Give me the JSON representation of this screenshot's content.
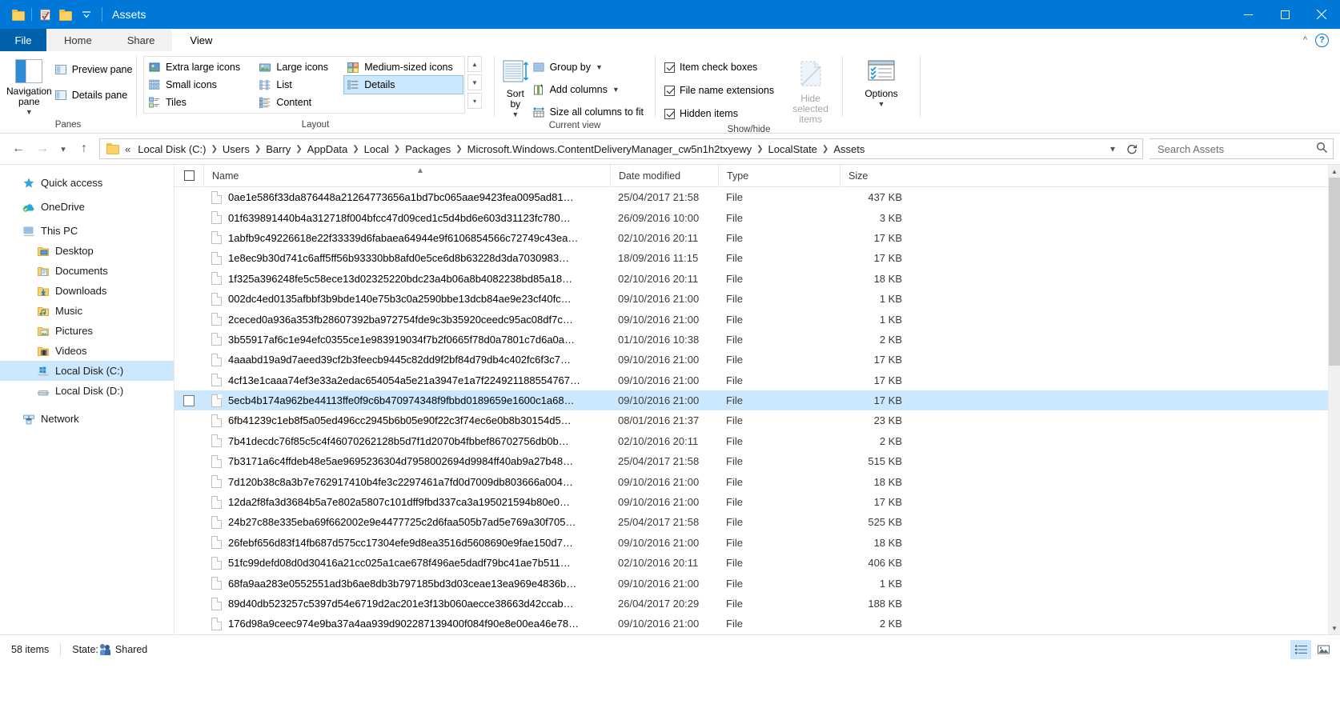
{
  "window": {
    "title": "Assets",
    "quick_access_icons": [
      "folder-icon",
      "properties-icon",
      "new-folder-icon",
      "customize-chevron-icon"
    ],
    "controls": {
      "minimize": "minimize-icon",
      "maximize": "maximize-icon",
      "close": "close-icon"
    }
  },
  "ribbon": {
    "file_tab": "File",
    "tabs": [
      {
        "label": "Home",
        "active": false
      },
      {
        "label": "Share",
        "active": false
      },
      {
        "label": "View",
        "active": true
      }
    ],
    "collapse_icon": "chevron-up-icon",
    "help_icon": "help-icon",
    "groups": [
      {
        "title": "Panes",
        "big_button": {
          "label": "Navigation pane",
          "icon": "navigation-pane-icon",
          "has_dropdown": true
        },
        "items": [
          {
            "label": "Preview pane",
            "icon": "preview-pane-icon"
          },
          {
            "label": "Details pane",
            "icon": "details-pane-icon"
          }
        ]
      },
      {
        "title": "Layout",
        "items": [
          {
            "label": "Extra large icons",
            "icon": "extra-large-icons-icon",
            "selected": false
          },
          {
            "label": "Large icons",
            "icon": "large-icons-icon",
            "selected": false
          },
          {
            "label": "Medium-sized icons",
            "icon": "medium-icons-icon",
            "selected": false
          },
          {
            "label": "Small icons",
            "icon": "small-icons-icon",
            "selected": false
          },
          {
            "label": "List",
            "icon": "list-icon",
            "selected": false
          },
          {
            "label": "Details",
            "icon": "details-icon",
            "selected": true
          },
          {
            "label": "Tiles",
            "icon": "tiles-icon",
            "selected": false
          },
          {
            "label": "Content",
            "icon": "content-icon",
            "selected": false
          }
        ],
        "scroll_icons": [
          "scroll-up-icon",
          "scroll-down-icon",
          "more-icon"
        ]
      },
      {
        "title": "Current view",
        "big_button": {
          "label": "Sort by",
          "icon": "sort-by-icon",
          "has_dropdown": true
        },
        "items": [
          {
            "label": "Group by",
            "icon": "group-by-icon",
            "has_dropdown": true
          },
          {
            "label": "Add columns",
            "icon": "add-columns-icon",
            "has_dropdown": true
          },
          {
            "label": "Size all columns to fit",
            "icon": "size-columns-icon",
            "has_dropdown": false
          }
        ]
      },
      {
        "title": "Show/hide",
        "checkboxes": [
          {
            "label": "Item check boxes",
            "checked": true
          },
          {
            "label": "File name extensions",
            "checked": true
          },
          {
            "label": "Hidden items",
            "checked": true
          }
        ],
        "big_buttons": [
          {
            "label": "Hide selected items",
            "icon": "hide-selected-items-icon",
            "disabled": true
          }
        ]
      },
      {
        "title": "",
        "big_buttons": [
          {
            "label": "Options",
            "icon": "options-icon",
            "has_dropdown": true,
            "disabled": false
          }
        ]
      }
    ]
  },
  "address": {
    "back_icon": "back-arrow-icon",
    "forward_icon": "forward-arrow-icon",
    "recent_icon": "recent-locations-icon",
    "up_icon": "up-arrow-icon",
    "folder_icon": "folder-icon",
    "overflow": "«",
    "crumbs": [
      "Local Disk (C:)",
      "Users",
      "Barry",
      "AppData",
      "Local",
      "Packages",
      "Microsoft.Windows.ContentDeliveryManager_cw5n1h2txyewy",
      "LocalState",
      "Assets"
    ],
    "dropdown_icon": "chevron-down-icon",
    "refresh_icon": "refresh-icon",
    "search_placeholder": "Search Assets",
    "search_icon": "search-icon",
    "search_value": ""
  },
  "sidebar": {
    "items": [
      {
        "label": "Quick access",
        "icon": "star-icon",
        "indent": false,
        "selected": false
      },
      {
        "label": "OneDrive",
        "icon": "onedrive-icon",
        "indent": false,
        "selected": false
      },
      {
        "label": "This PC",
        "icon": "this-pc-icon",
        "indent": false,
        "selected": false
      },
      {
        "label": "Desktop",
        "icon": "desktop-folder-icon",
        "indent": true,
        "selected": false
      },
      {
        "label": "Documents",
        "icon": "documents-folder-icon",
        "indent": true,
        "selected": false
      },
      {
        "label": "Downloads",
        "icon": "downloads-folder-icon",
        "indent": true,
        "selected": false
      },
      {
        "label": "Music",
        "icon": "music-folder-icon",
        "indent": true,
        "selected": false
      },
      {
        "label": "Pictures",
        "icon": "pictures-folder-icon",
        "indent": true,
        "selected": false
      },
      {
        "label": "Videos",
        "icon": "videos-folder-icon",
        "indent": true,
        "selected": false
      },
      {
        "label": "Local Disk (C:)",
        "icon": "windows-drive-icon",
        "indent": true,
        "selected": true
      },
      {
        "label": "Local Disk (D:)",
        "icon": "drive-icon",
        "indent": true,
        "selected": false
      },
      {
        "label": "Network",
        "icon": "network-icon",
        "indent": false,
        "selected": false
      }
    ]
  },
  "filelist": {
    "columns": [
      {
        "key": "name",
        "label": "Name",
        "sorted": true,
        "sort_dir": "asc"
      },
      {
        "key": "date",
        "label": "Date modified"
      },
      {
        "key": "type",
        "label": "Type"
      },
      {
        "key": "size",
        "label": "Size"
      }
    ],
    "header_checkbox": false,
    "rows": [
      {
        "name": "0ae1e586f33da876448a21264773656a1bd7bc065aae9423fea0095ad81…",
        "date": "25/04/2017 21:58",
        "type": "File",
        "size": "437 KB",
        "selected": false
      },
      {
        "name": "01f639891440b4a312718f004bfcc47d09ced1c5d4bd6e603d31123fc780…",
        "date": "26/09/2016 10:00",
        "type": "File",
        "size": "3 KB",
        "selected": false
      },
      {
        "name": "1abfb9c49226618e22f33339d6fabaea64944e9f6106854566c72749c43ea…",
        "date": "02/10/2016 20:11",
        "type": "File",
        "size": "17 KB",
        "selected": false
      },
      {
        "name": "1e8ec9b30d741c6aff5ff56b93330bb8afd0e5ce6d8b63228d3da7030983…",
        "date": "18/09/2016 11:15",
        "type": "File",
        "size": "17 KB",
        "selected": false
      },
      {
        "name": "1f325a396248fe5c58ece13d02325220bdc23a4b06a8b4082238bd85a18…",
        "date": "02/10/2016 20:11",
        "type": "File",
        "size": "18 KB",
        "selected": false
      },
      {
        "name": "002dc4ed0135afbbf3b9bde140e75b3c0a2590bbe13dcb84ae9e23cf40fc…",
        "date": "09/10/2016 21:00",
        "type": "File",
        "size": "1 KB",
        "selected": false
      },
      {
        "name": "2ceced0a936a353fb28607392ba972754fde9c3b35920ceedc95ac08df7c…",
        "date": "09/10/2016 21:00",
        "type": "File",
        "size": "1 KB",
        "selected": false
      },
      {
        "name": "3b55917af6c1e94efc0355ce1e983919034f7b2f0665f78d0a7801c7d6a0a…",
        "date": "01/10/2016 10:38",
        "type": "File",
        "size": "2 KB",
        "selected": false
      },
      {
        "name": "4aaabd19a9d7aeed39cf2b3feecb9445c82dd9f2bf84d79db4c402fc6f3c7…",
        "date": "09/10/2016 21:00",
        "type": "File",
        "size": "17 KB",
        "selected": false
      },
      {
        "name": "4cf13e1caaa74ef3e33a2edac654054a5e21a3947e1a7f224921188554767…",
        "date": "09/10/2016 21:00",
        "type": "File",
        "size": "17 KB",
        "selected": false
      },
      {
        "name": "5ecb4b174a962be44113ffe0f9c6b470974348f9fbbd0189659e1600c1a68…",
        "date": "09/10/2016 21:00",
        "type": "File",
        "size": "17 KB",
        "selected": true
      },
      {
        "name": "6fb41239c1eb8f5a05ed496cc2945b6b05e90f22c3f74ec6e0b8b30154d5…",
        "date": "08/01/2016 21:37",
        "type": "File",
        "size": "23 KB",
        "selected": false
      },
      {
        "name": "7b41decdc76f85c5c4f46070262128b5d7f1d2070b4fbbef86702756db0b…",
        "date": "02/10/2016 20:11",
        "type": "File",
        "size": "2 KB",
        "selected": false
      },
      {
        "name": "7b3171a6c4ffdeb48e5ae9695236304d7958002694d9984ff40ab9a27b48…",
        "date": "25/04/2017 21:58",
        "type": "File",
        "size": "515 KB",
        "selected": false
      },
      {
        "name": "7d120b38c8a3b7e762917410b4fe3c2297461a7fd0d7009db803666a004…",
        "date": "09/10/2016 21:00",
        "type": "File",
        "size": "18 KB",
        "selected": false
      },
      {
        "name": "12da2f8fa3d3684b5a7e802a5807c101dff9fbd337ca3a195021594b80e0…",
        "date": "09/10/2016 21:00",
        "type": "File",
        "size": "17 KB",
        "selected": false
      },
      {
        "name": "24b27c88e335eba69f662002e9e4477725c2d6faa505b7ad5e769a30f705…",
        "date": "25/04/2017 21:58",
        "type": "File",
        "size": "525 KB",
        "selected": false
      },
      {
        "name": "26febf656d83f14fb687d575cc17304efe9d8ea3516d5608690e9fae150d7…",
        "date": "09/10/2016 21:00",
        "type": "File",
        "size": "18 KB",
        "selected": false
      },
      {
        "name": "51fc99defd08d0d30416a21cc025a1cae678f496ae5dadf79bc41ae7b511…",
        "date": "02/10/2016 20:11",
        "type": "File",
        "size": "406 KB",
        "selected": false
      },
      {
        "name": "68fa9aa283e0552551ad3b6ae8db3b797185bd3d03ceae13ea969e4836b…",
        "date": "09/10/2016 21:00",
        "type": "File",
        "size": "1 KB",
        "selected": false
      },
      {
        "name": "89d40db523257c5397d54e6719d2ac201e3f13b060aecce38663d42ccab…",
        "date": "26/04/2017 20:29",
        "type": "File",
        "size": "188 KB",
        "selected": false
      },
      {
        "name": "176d98a9ceec974e9ba37a4aa939d902287139400f084f90e8e00ea46e78…",
        "date": "09/10/2016 21:00",
        "type": "File",
        "size": "2 KB",
        "selected": false
      }
    ]
  },
  "statusbar": {
    "item_count": "58 items",
    "state_label": "State:",
    "state_value": "Shared",
    "state_icon": "shared-people-icon",
    "details_view_icon": "details-view-icon",
    "large-icons_view_icon": "large-icons-view-icon"
  },
  "colors": {
    "accent": "#0078d7",
    "selection": "#cce8ff",
    "hover": "#e5f3ff"
  }
}
